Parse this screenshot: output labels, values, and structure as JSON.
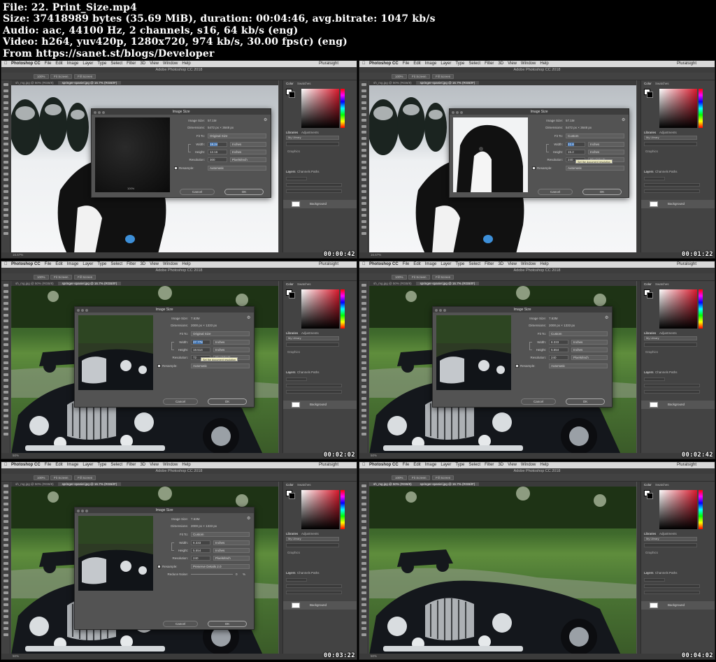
{
  "info": {
    "line1": "File: 22. Print_Size.mp4",
    "line2": "Size: 37418989 bytes (35.69 MiB), duration: 00:04:46, avg.bitrate: 1047 kb/s",
    "line3": "Audio: aac, 44100 Hz, 2 channels, s16, 64 kb/s (eng)",
    "line4": "Video: h264, yuv420p, 1280x720, 974 kb/s, 30.00 fps(r) (eng)",
    "line5": "From https://sanet.st/blogs/Developer"
  },
  "app": {
    "brand": "Photoshop CC",
    "menus": [
      "File",
      "Edit",
      "Image",
      "Layer",
      "Type",
      "Select",
      "Filter",
      "3D",
      "View",
      "Window",
      "Help"
    ],
    "window_title": "Adobe Photoshop CC 2018",
    "right_label": "Pluralsight",
    "opt_zoom": "100%",
    "opt_fit": "Fit Screen",
    "opt_fill": "Fill Screen",
    "panel_color": "Color",
    "panel_swatches": "Swatches",
    "panel_libraries": "Libraries",
    "panel_adjustments": "Adjustments",
    "library_name": "My Library",
    "graphics": "Graphics",
    "layers": "Layers",
    "channels": "Channels",
    "paths": "Paths",
    "layer_name": "Background",
    "dialog_title": "Image Size",
    "lbl_imagesize": "Image Size:",
    "lbl_dimensions": "Dimensions:",
    "lbl_fitto": "Fit To:",
    "lbl_width": "Width:",
    "lbl_height": "Height:",
    "lbl_resolution": "Resolution:",
    "lbl_resample": "Resample:",
    "lbl_reduce": "Reduce Noise:",
    "unit_inches": "Inches",
    "unit_ppi": "Pixels/Inch",
    "cancel": "Cancel",
    "ok": "OK",
    "tooltip": "Set the document resolution"
  },
  "frames": [
    {
      "timestamp": "00:00:42",
      "tab1": "sh_mg.jpg @ 50% (RGB/8)",
      "tab2": "springer-spaniel.jpg @ 16.7% (RGB/8*)",
      "status": "16.67%",
      "image_size": "57.1M",
      "dimensions": "5472 px × 3648 px",
      "fit_to": "Original Size",
      "width": "18.24",
      "height": "12.16",
      "resolution": "300",
      "resample": "Automatic",
      "preview_zoom": "100%"
    },
    {
      "timestamp": "00:01:22",
      "tab1": "sh_mg.jpg @ 50% (RGB/8)",
      "tab2": "springer-spaniel.jpg @ 16.7% (RGB/8*)",
      "status": "16.67%",
      "image_size": "57.1M",
      "dimensions": "5472 px × 3648 px",
      "fit_to": "Custom",
      "width": "22.8",
      "height": "15.2",
      "resolution": "240",
      "resample": "Automatic"
    },
    {
      "timestamp": "00:02:02",
      "tab1": "sh_mg.jpg @ 50% (RGB/8)",
      "tab2": "springer-spaniel.jpg @ 16.7% (RGB/8*)",
      "status": "50%",
      "image_size": "7.63M",
      "dimensions": "2000 px × 1333 px",
      "fit_to": "Original Size",
      "width": "27.778",
      "height": "18.514",
      "resolution": "72",
      "resample": "Automatic"
    },
    {
      "timestamp": "00:02:42",
      "tab1": "sh_mg.jpg @ 50% (RGB/8)",
      "tab2": "springer-spaniel.jpg @ 16.7% (RGB/8*)",
      "status": "50%",
      "image_size": "7.63M",
      "dimensions": "2000 px × 1333 px",
      "fit_to": "Custom",
      "width": "8.333",
      "height": "5.554",
      "resolution": "240",
      "resample": "Automatic"
    },
    {
      "timestamp": "00:03:22",
      "tab1": "sh_mg.jpg @ 50% (RGB/8)",
      "tab2": "springer-spaniel.jpg @ 16.7% (RGB/8*)",
      "status": "50%",
      "image_size": "7.63M",
      "dimensions": "2000 px × 1333 px",
      "fit_to": "Custom",
      "width": "8.333",
      "height": "5.554",
      "resolution": "240",
      "resample": "Preserve Details 2.0",
      "reduce_noise": "0",
      "reduce_unit": "%"
    },
    {
      "timestamp": "00:04:02",
      "tab1": "sh_mg.jpg @ 50% (RGB/8)",
      "tab2": "springer-spaniel.jpg @ 16.7% (RGB/8*)",
      "status": "50%"
    }
  ]
}
